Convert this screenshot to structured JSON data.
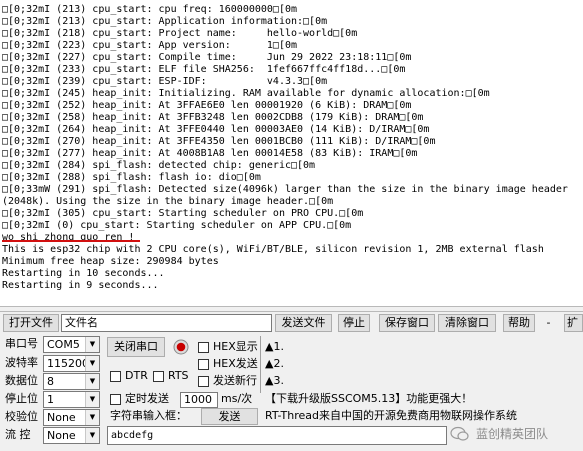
{
  "terminal": {
    "lines": [
      "□[0;32mI (213) cpu_start: cpu freq: 160000000□[0m",
      "□[0;32mI (213) cpu_start: Application information:□[0m",
      "□[0;32mI (218) cpu_start: Project name:     hello-world□[0m",
      "□[0;32mI (223) cpu_start: App version:      1□[0m",
      "□[0;32mI (227) cpu_start: Compile time:     Jun 29 2022 23:18:11□[0m",
      "□[0;32mI (233) cpu_start: ELF file SHA256:  1fef667ffc4ff18d...□[0m",
      "□[0;32mI (239) cpu_start: ESP-IDF:          v4.3.3□[0m",
      "□[0;32mI (245) heap_init: Initializing. RAM available for dynamic allocation:□[0m",
      "□[0;32mI (252) heap_init: At 3FFAE6E0 len 00001920 (6 KiB): DRAM□[0m",
      "□[0;32mI (258) heap_init: At 3FFB3248 len 0002CDB8 (179 KiB): DRAM□[0m",
      "□[0;32mI (264) heap_init: At 3FFE0440 len 00003AE0 (14 KiB): D/IRAM□[0m",
      "□[0;32mI (270) heap_init: At 3FFE4350 len 0001BCB0 (111 KiB): D/IRAM□[0m",
      "□[0;32mI (277) heap_init: At 4008B1A8 len 00014E58 (83 KiB): IRAM□[0m",
      "□[0;32mI (284) spi_flash: detected chip: generic□[0m",
      "□[0;32mI (288) spi_flash: flash io: dio□[0m",
      "□[0;33mW (291) spi_flash: Detected size(4096k) larger than the size in the binary image header",
      "(2048k). Using the size in the binary image header.□[0m",
      "□[0;32mI (305) cpu_start: Starting scheduler on PRO CPU.□[0m",
      "□[0;32mI (0) cpu_start: Starting scheduler on APP CPU.□[0m",
      "wo shi zhong guo ren !",
      "This is esp32 chip with 2 CPU core(s), WiFi/BT/BLE, silicon revision 1, 2MB external flash",
      "Minimum free heap size: 290984 bytes",
      "Restarting in 10 seconds...",
      "Restarting in 9 seconds..."
    ]
  },
  "toolbar": {
    "open_file": "打开文件",
    "filename": "文件名",
    "send_file": "发送文件",
    "stop": "停止",
    "save_window": "保存窗口",
    "clear_window": "清除窗口",
    "help": "帮助",
    "minus": "-",
    "more": "扩"
  },
  "settings": {
    "port_label": "串口号",
    "port_value": "COM5",
    "baud_label": "波特率",
    "baud_value": "115200",
    "databits_label": "数据位",
    "databits_value": "8",
    "stopbits_label": "停止位",
    "stopbits_value": "1",
    "parity_label": "校验位",
    "parity_value": "None",
    "flow_label": "流 控",
    "flow_value": "None"
  },
  "controls": {
    "close_port": "关闭串口",
    "hex_display": "HEX显示",
    "hex_send": "HEX发送",
    "send_newline": "发送新行",
    "dtr": "DTR",
    "rts": "RTS",
    "timed_send": "定时发送",
    "interval": "1000",
    "interval_unit": "ms/次",
    "string_input_label": "字符串输入框：",
    "send": "发送",
    "input_value": "abcdefg",
    "ann1": "▲1.",
    "ann2": "▲2.",
    "ann3": "▲3.",
    "download_link": "【下载升级版SSCOM5.13】功能更强大！",
    "rt_thread": "RT-Thread来自中国的开源免费商用物联网操作系统"
  },
  "watermark": "蓝创精英团队",
  "colors": {
    "panel_bg": "#f0f0f0",
    "underline": "#d21010",
    "record_led": "#c80000"
  }
}
